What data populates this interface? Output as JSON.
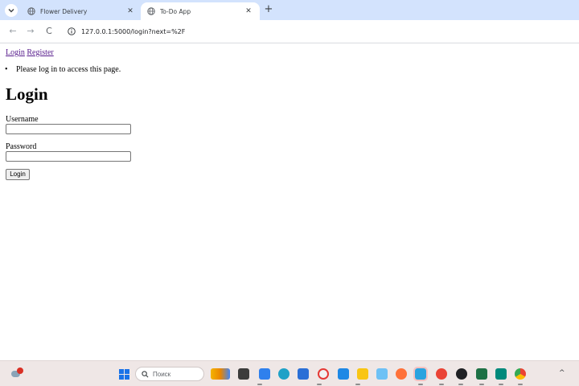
{
  "browser": {
    "tabs": [
      {
        "title": "Flower Delivery",
        "close": "✕"
      },
      {
        "title": "To-Do App",
        "close": "✕"
      }
    ],
    "new_tab": "+",
    "nav": {
      "back": "←",
      "forward": "→",
      "reload": "C"
    },
    "url": "127.0.0.1:5000/login?next=%2F"
  },
  "page": {
    "nav_links": {
      "login": "Login",
      "register": "Register"
    },
    "flash_message": "Please log in to access this page.",
    "heading": "Login",
    "username_label": "Username",
    "username_value": "",
    "password_label": "Password",
    "password_value": "",
    "submit_label": "Login"
  },
  "taskbar": {
    "search_placeholder": "Поиск",
    "tray_chevron": "^"
  },
  "colors": {
    "tabstrip": "#d3e3fd",
    "link": "#551a8b",
    "taskbar": "#efe7e6"
  }
}
